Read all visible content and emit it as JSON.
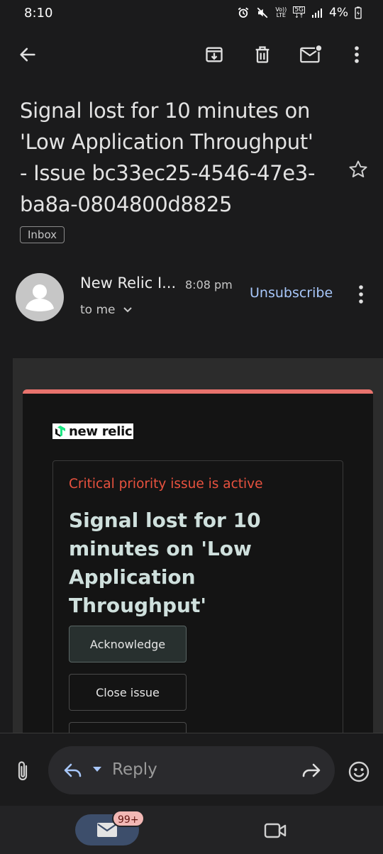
{
  "status_bar": {
    "time": "8:10",
    "volte": "Vo))",
    "lte": "LTE",
    "network": "5G",
    "battery": "4%"
  },
  "toolbar": {
    "icons": [
      "back-arrow-icon",
      "archive-icon",
      "delete-icon",
      "mark-unread-icon",
      "more-vert-icon"
    ]
  },
  "email": {
    "subject": "Signal lost for 10 minutes on 'Low Application Throughput' - Issue bc33ec25-4546-47e3-ba8a-0804800d8825",
    "label": "Inbox",
    "sender": "New Relic I...",
    "time": "8:08 pm",
    "recipient": "to me",
    "unsubscribe": "Unsubscribe"
  },
  "body": {
    "logo_text": "new relic",
    "priority": "Critical priority issue is active",
    "title": "Signal lost for 10 minutes on 'Low Application Throughput'",
    "buttons": {
      "acknowledge": "Acknowledge",
      "close": "Close issue"
    },
    "colors": {
      "accent": "#e8736d",
      "priority": "#e9523f",
      "title": "#cfe0dd"
    }
  },
  "reply_bar": {
    "placeholder": "Reply"
  },
  "bottom_nav": {
    "mail_badge": "99+"
  }
}
